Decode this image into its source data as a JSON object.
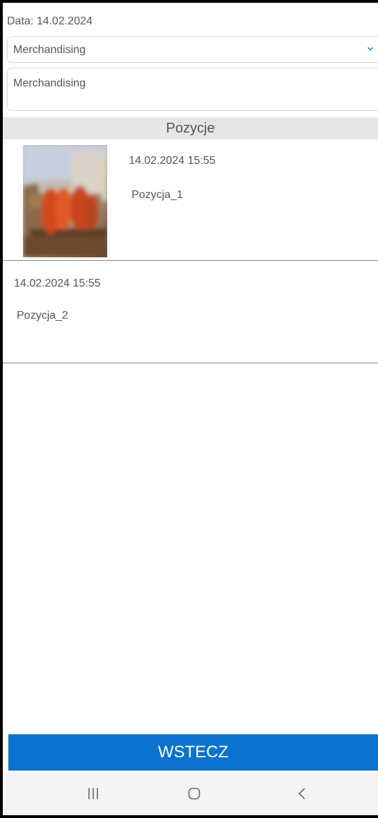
{
  "form": {
    "date_text": "Data: 14.02.2024",
    "category_select": {
      "selected": "Merchandising",
      "icon": "chevron-down-icon"
    },
    "description_value": "Merchandising"
  },
  "positions": {
    "header": "Pozycje",
    "items": [
      {
        "timestamp": "14.02.2024 15:55",
        "name": "Pozycja_1",
        "has_photo": true
      },
      {
        "timestamp": "14.02.2024 15:55",
        "name": "Pozycja_2",
        "has_photo": false
      }
    ]
  },
  "footer": {
    "back_label": "WSTECZ"
  },
  "navbar": {
    "icons": [
      "recent-apps-icon",
      "home-icon",
      "back-icon"
    ]
  },
  "colors": {
    "accent": "#0A72CF",
    "header_bg": "#E6E6E6",
    "text": "#555555",
    "chevron": "#2B8FE0"
  }
}
